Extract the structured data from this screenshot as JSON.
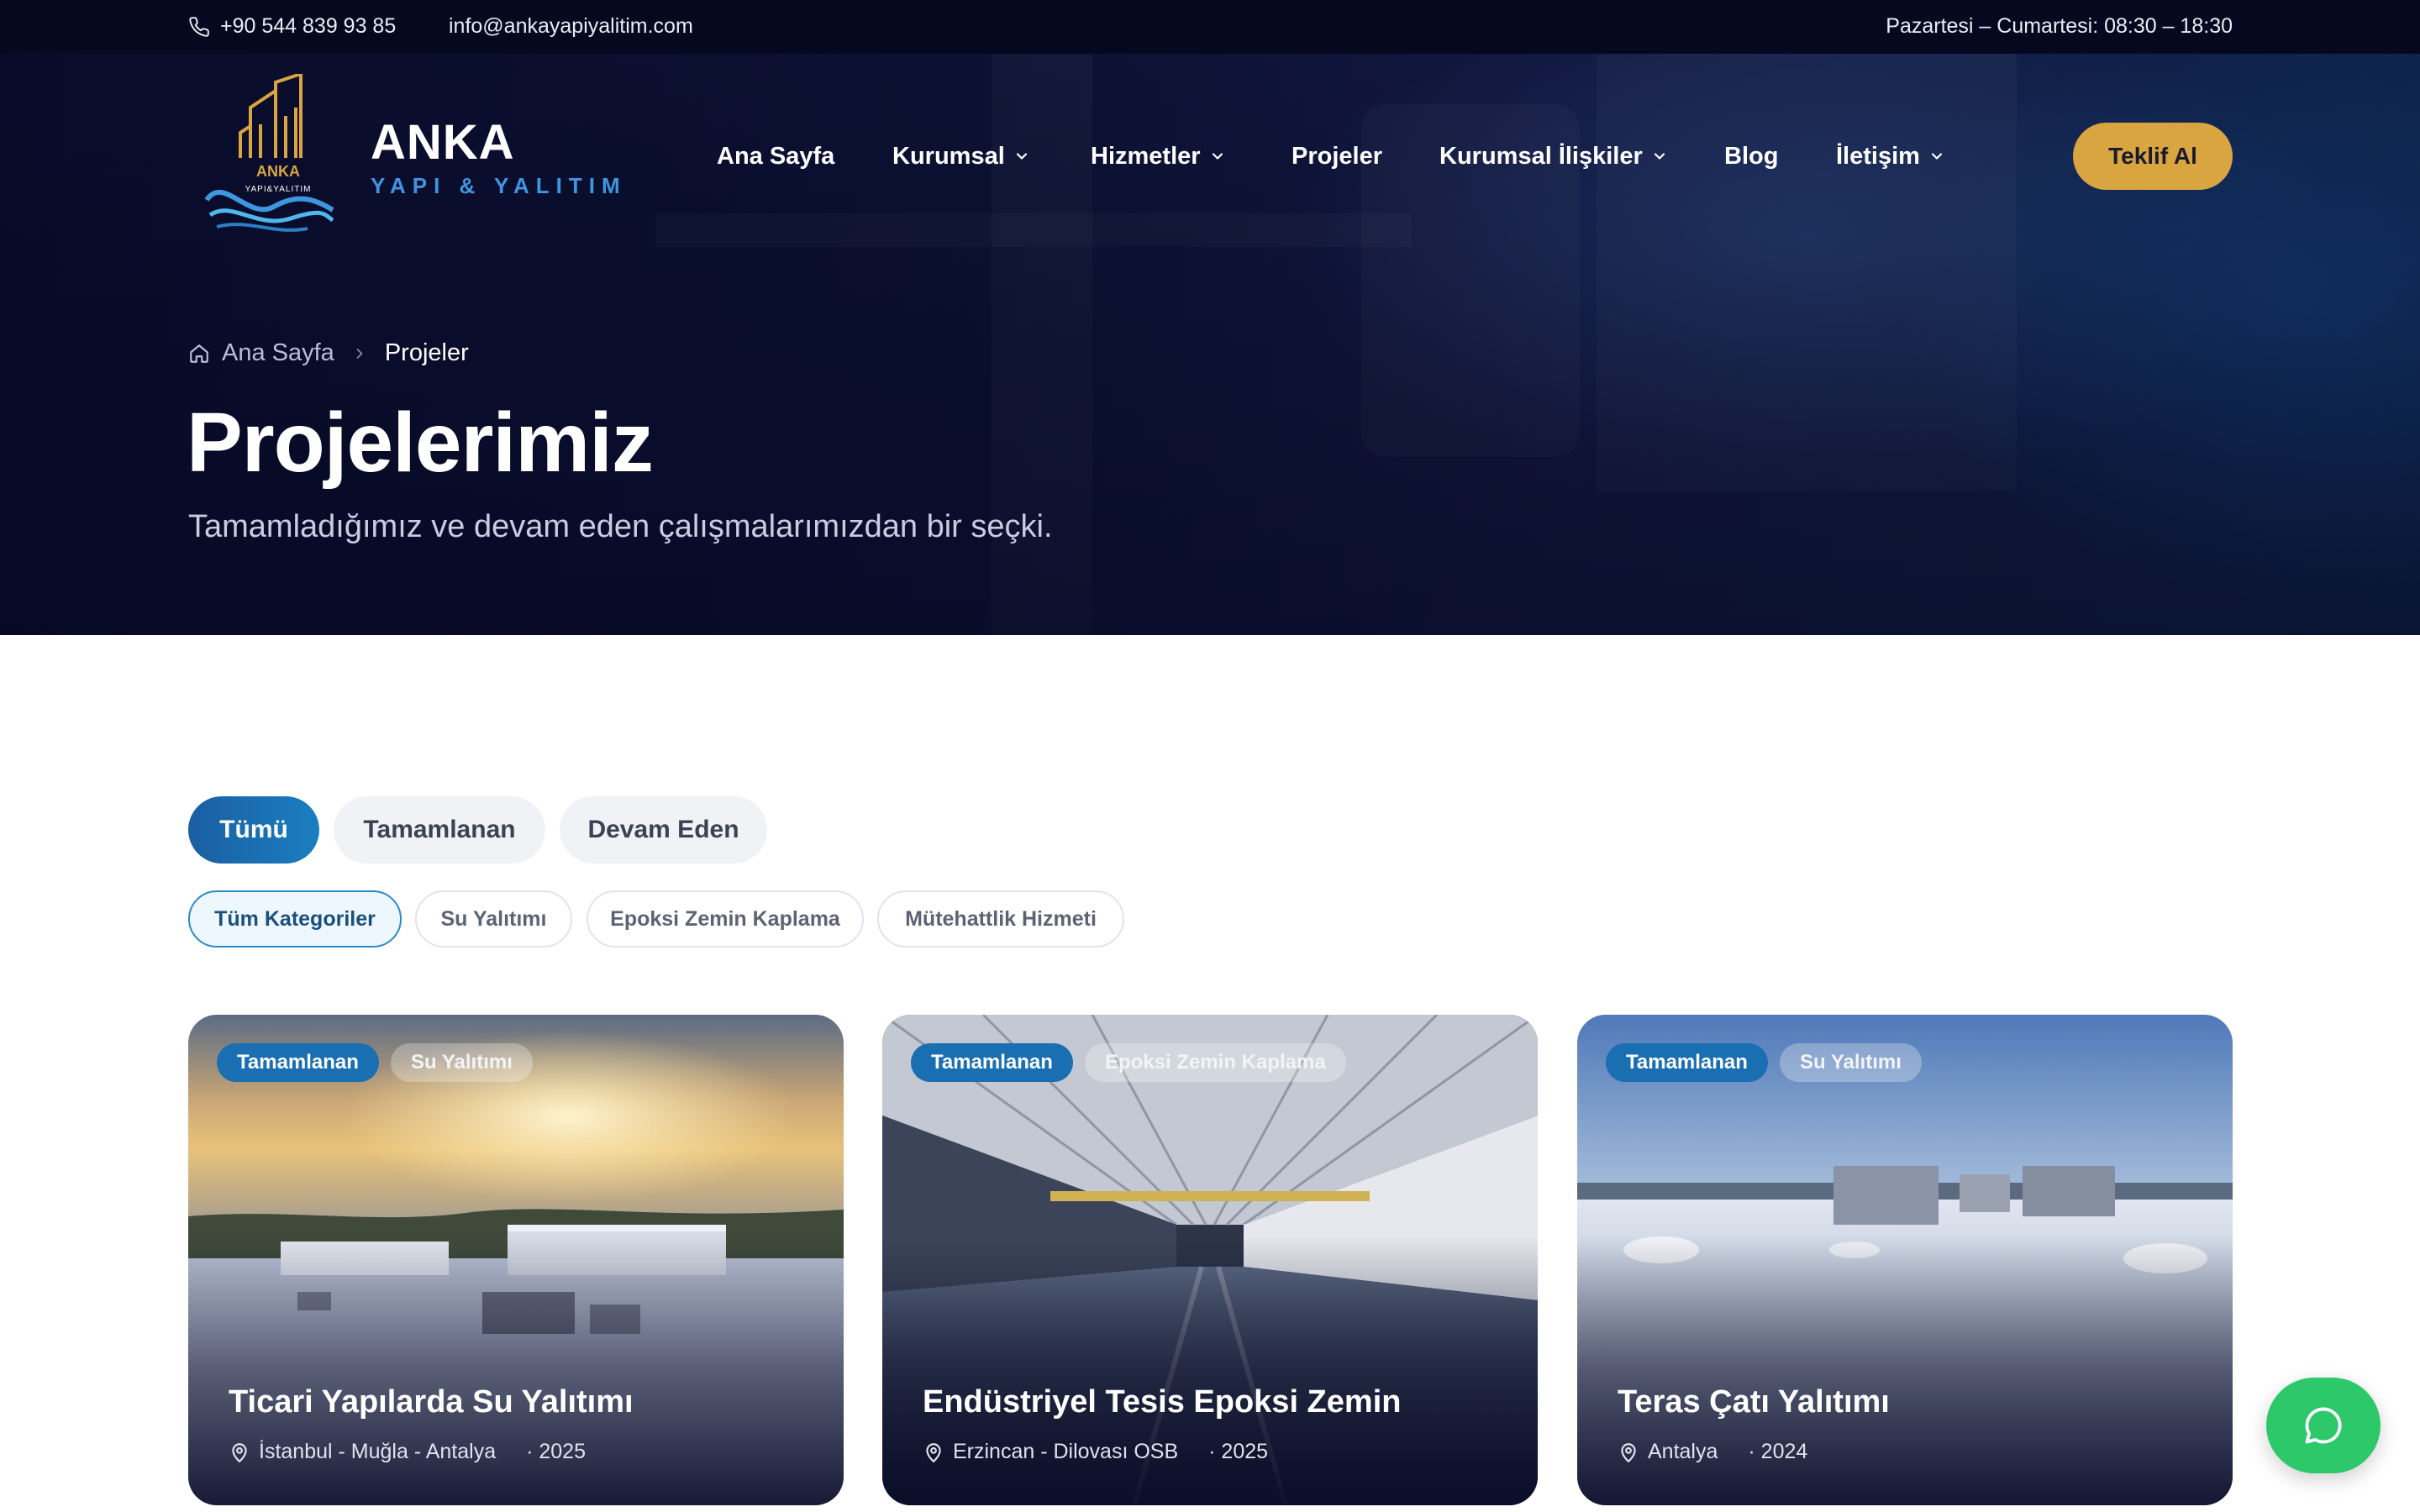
{
  "topbar": {
    "phone": "+90 544 839 93 85",
    "email": "info@ankayapiyalitim.com",
    "hours": "Pazartesi – Cumartesi: 08:30 – 18:30"
  },
  "brand": {
    "name": "ANKA",
    "subtitle": "YAPI & YALITIM",
    "logo_text_main": "ANKA",
    "logo_text_sub": "YAPI&YALITIM"
  },
  "nav": {
    "items": [
      {
        "label": "Ana Sayfa",
        "has_dropdown": false
      },
      {
        "label": "Kurumsal",
        "has_dropdown": true
      },
      {
        "label": "Hizmetler",
        "has_dropdown": true
      },
      {
        "label": "Projeler",
        "has_dropdown": false
      },
      {
        "label": "Kurumsal İlişkiler",
        "has_dropdown": true
      },
      {
        "label": "Blog",
        "has_dropdown": false
      },
      {
        "label": "İletişim",
        "has_dropdown": true
      }
    ],
    "cta_label": "Teklif Al"
  },
  "breadcrumb": {
    "home": "Ana Sayfa",
    "current": "Projeler"
  },
  "hero": {
    "title": "Projelerimiz",
    "subtitle": "Tamamladığımız ve devam eden çalışmalarımızdan bir seçki."
  },
  "status_filters": [
    {
      "label": "Tümü",
      "active": true
    },
    {
      "label": "Tamamlanan",
      "active": false
    },
    {
      "label": "Devam Eden",
      "active": false
    }
  ],
  "category_filters": [
    {
      "label": "Tüm Kategoriler",
      "active": true
    },
    {
      "label": "Su Yalıtımı",
      "active": false
    },
    {
      "label": "Epoksi Zemin Kaplama",
      "active": false
    },
    {
      "label": "Mütehattlik Hizmeti",
      "active": false
    }
  ],
  "projects": [
    {
      "status": "Tamamlanan",
      "category": "Su Yalıtımı",
      "title": "Ticari Yapılarda Su Yalıtımı",
      "location": "İstanbul - Muğla - Antalya",
      "year": "· 2025"
    },
    {
      "status": "Tamamlanan",
      "category": "Epoksi Zemin Kaplama",
      "title": "Endüstriyel Tesis Epoksi Zemin",
      "location": "Erzincan - Dilovası OSB",
      "year": "· 2025"
    },
    {
      "status": "Tamamlanan",
      "category": "Su Yalıtımı",
      "title": "Teras Çatı Yalıtımı",
      "location": "Antalya",
      "year": "· 2024"
    }
  ],
  "icons": [
    "phone-icon",
    "mail-icon",
    "home-icon",
    "chevron-right-icon",
    "chevron-down-icon",
    "map-pin-icon",
    "chat-icon"
  ],
  "colors": {
    "topbar": "#06081f",
    "accent_gold": "#d9a540",
    "accent_blue": "#1a6fb3",
    "brand_sub": "#3d97e0",
    "chat_green": "#2cc86a"
  }
}
